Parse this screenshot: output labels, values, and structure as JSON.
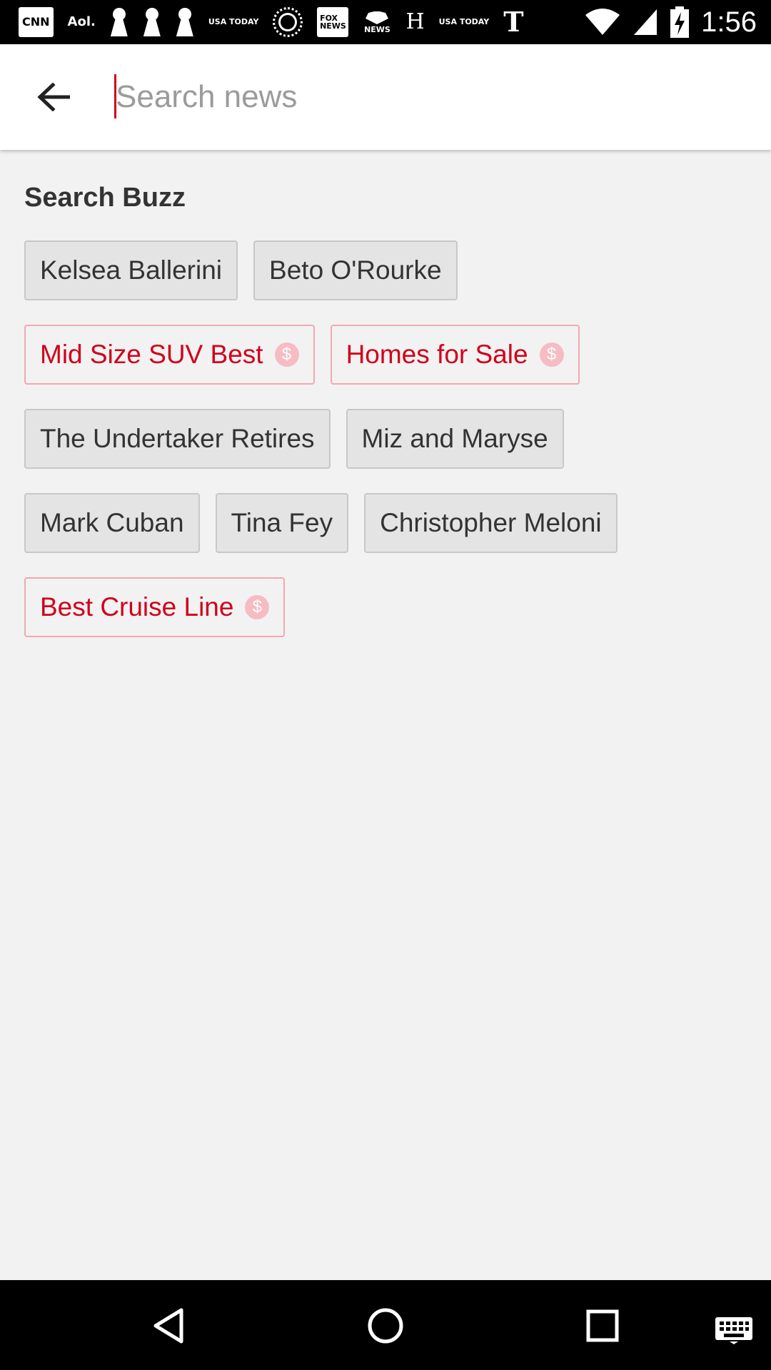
{
  "status_bar": {
    "notification_icons": [
      {
        "name": "cnn-icon",
        "label": "CNN"
      },
      {
        "name": "aol-icon",
        "label": "Aol."
      },
      {
        "name": "keyhole-icon",
        "label": ""
      },
      {
        "name": "keyhole-icon",
        "label": ""
      },
      {
        "name": "keyhole-icon",
        "label": ""
      },
      {
        "name": "usa-today-icon",
        "label": "USA TODAY"
      },
      {
        "name": "dotted-circle-icon",
        "label": ""
      },
      {
        "name": "fox-news-icon",
        "label": "FOX NEWS"
      },
      {
        "name": "nbc-news-icon",
        "label": "NEWS"
      },
      {
        "name": "h-icon",
        "label": "H"
      },
      {
        "name": "usa-today-icon",
        "label": "USA TODAY"
      },
      {
        "name": "nyt-icon",
        "label": "T"
      }
    ],
    "time": "1:56"
  },
  "search": {
    "placeholder": "Search news",
    "value": ""
  },
  "buzz": {
    "title": "Search Buzz",
    "rows": [
      [
        {
          "label": "Kelsea Ballerini",
          "sponsored": false
        },
        {
          "label": "Beto O'Rourke",
          "sponsored": false
        }
      ],
      [
        {
          "label": "Mid Size SUV Best",
          "sponsored": true
        },
        {
          "label": "Homes for Sale",
          "sponsored": true
        }
      ],
      [
        {
          "label": "The Undertaker Retires",
          "sponsored": false
        },
        {
          "label": "Miz and Maryse",
          "sponsored": false
        }
      ],
      [
        {
          "label": "Mark Cuban",
          "sponsored": false
        },
        {
          "label": "Tina Fey",
          "sponsored": false
        },
        {
          "label": "Christopher Meloni",
          "sponsored": false
        }
      ],
      [
        {
          "label": "Best Cruise Line",
          "sponsored": true
        }
      ]
    ],
    "sponsored_glyph": "$"
  },
  "colors": {
    "accent": "#d0021b",
    "chip_bg": "#e4e4e4",
    "page_bg": "#f2f2f2"
  }
}
